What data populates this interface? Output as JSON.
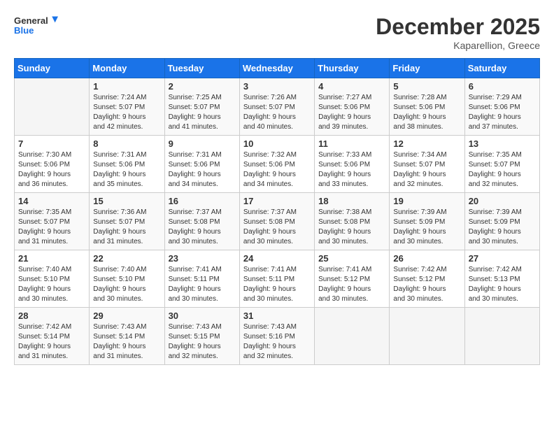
{
  "logo": {
    "line1": "General",
    "line2": "Blue"
  },
  "title": "December 2025",
  "location": "Kaparellion, Greece",
  "weekdays": [
    "Sunday",
    "Monday",
    "Tuesday",
    "Wednesday",
    "Thursday",
    "Friday",
    "Saturday"
  ],
  "weeks": [
    [
      {
        "day": "",
        "info": ""
      },
      {
        "day": "1",
        "info": "Sunrise: 7:24 AM\nSunset: 5:07 PM\nDaylight: 9 hours\nand 42 minutes."
      },
      {
        "day": "2",
        "info": "Sunrise: 7:25 AM\nSunset: 5:07 PM\nDaylight: 9 hours\nand 41 minutes."
      },
      {
        "day": "3",
        "info": "Sunrise: 7:26 AM\nSunset: 5:07 PM\nDaylight: 9 hours\nand 40 minutes."
      },
      {
        "day": "4",
        "info": "Sunrise: 7:27 AM\nSunset: 5:06 PM\nDaylight: 9 hours\nand 39 minutes."
      },
      {
        "day": "5",
        "info": "Sunrise: 7:28 AM\nSunset: 5:06 PM\nDaylight: 9 hours\nand 38 minutes."
      },
      {
        "day": "6",
        "info": "Sunrise: 7:29 AM\nSunset: 5:06 PM\nDaylight: 9 hours\nand 37 minutes."
      }
    ],
    [
      {
        "day": "7",
        "info": "Sunrise: 7:30 AM\nSunset: 5:06 PM\nDaylight: 9 hours\nand 36 minutes."
      },
      {
        "day": "8",
        "info": "Sunrise: 7:31 AM\nSunset: 5:06 PM\nDaylight: 9 hours\nand 35 minutes."
      },
      {
        "day": "9",
        "info": "Sunrise: 7:31 AM\nSunset: 5:06 PM\nDaylight: 9 hours\nand 34 minutes."
      },
      {
        "day": "10",
        "info": "Sunrise: 7:32 AM\nSunset: 5:06 PM\nDaylight: 9 hours\nand 34 minutes."
      },
      {
        "day": "11",
        "info": "Sunrise: 7:33 AM\nSunset: 5:06 PM\nDaylight: 9 hours\nand 33 minutes."
      },
      {
        "day": "12",
        "info": "Sunrise: 7:34 AM\nSunset: 5:07 PM\nDaylight: 9 hours\nand 32 minutes."
      },
      {
        "day": "13",
        "info": "Sunrise: 7:35 AM\nSunset: 5:07 PM\nDaylight: 9 hours\nand 32 minutes."
      }
    ],
    [
      {
        "day": "14",
        "info": "Sunrise: 7:35 AM\nSunset: 5:07 PM\nDaylight: 9 hours\nand 31 minutes."
      },
      {
        "day": "15",
        "info": "Sunrise: 7:36 AM\nSunset: 5:07 PM\nDaylight: 9 hours\nand 31 minutes."
      },
      {
        "day": "16",
        "info": "Sunrise: 7:37 AM\nSunset: 5:08 PM\nDaylight: 9 hours\nand 30 minutes."
      },
      {
        "day": "17",
        "info": "Sunrise: 7:37 AM\nSunset: 5:08 PM\nDaylight: 9 hours\nand 30 minutes."
      },
      {
        "day": "18",
        "info": "Sunrise: 7:38 AM\nSunset: 5:08 PM\nDaylight: 9 hours\nand 30 minutes."
      },
      {
        "day": "19",
        "info": "Sunrise: 7:39 AM\nSunset: 5:09 PM\nDaylight: 9 hours\nand 30 minutes."
      },
      {
        "day": "20",
        "info": "Sunrise: 7:39 AM\nSunset: 5:09 PM\nDaylight: 9 hours\nand 30 minutes."
      }
    ],
    [
      {
        "day": "21",
        "info": "Sunrise: 7:40 AM\nSunset: 5:10 PM\nDaylight: 9 hours\nand 30 minutes."
      },
      {
        "day": "22",
        "info": "Sunrise: 7:40 AM\nSunset: 5:10 PM\nDaylight: 9 hours\nand 30 minutes."
      },
      {
        "day": "23",
        "info": "Sunrise: 7:41 AM\nSunset: 5:11 PM\nDaylight: 9 hours\nand 30 minutes."
      },
      {
        "day": "24",
        "info": "Sunrise: 7:41 AM\nSunset: 5:11 PM\nDaylight: 9 hours\nand 30 minutes."
      },
      {
        "day": "25",
        "info": "Sunrise: 7:41 AM\nSunset: 5:12 PM\nDaylight: 9 hours\nand 30 minutes."
      },
      {
        "day": "26",
        "info": "Sunrise: 7:42 AM\nSunset: 5:12 PM\nDaylight: 9 hours\nand 30 minutes."
      },
      {
        "day": "27",
        "info": "Sunrise: 7:42 AM\nSunset: 5:13 PM\nDaylight: 9 hours\nand 30 minutes."
      }
    ],
    [
      {
        "day": "28",
        "info": "Sunrise: 7:42 AM\nSunset: 5:14 PM\nDaylight: 9 hours\nand 31 minutes."
      },
      {
        "day": "29",
        "info": "Sunrise: 7:43 AM\nSunset: 5:14 PM\nDaylight: 9 hours\nand 31 minutes."
      },
      {
        "day": "30",
        "info": "Sunrise: 7:43 AM\nSunset: 5:15 PM\nDaylight: 9 hours\nand 32 minutes."
      },
      {
        "day": "31",
        "info": "Sunrise: 7:43 AM\nSunset: 5:16 PM\nDaylight: 9 hours\nand 32 minutes."
      },
      {
        "day": "",
        "info": ""
      },
      {
        "day": "",
        "info": ""
      },
      {
        "day": "",
        "info": ""
      }
    ]
  ]
}
